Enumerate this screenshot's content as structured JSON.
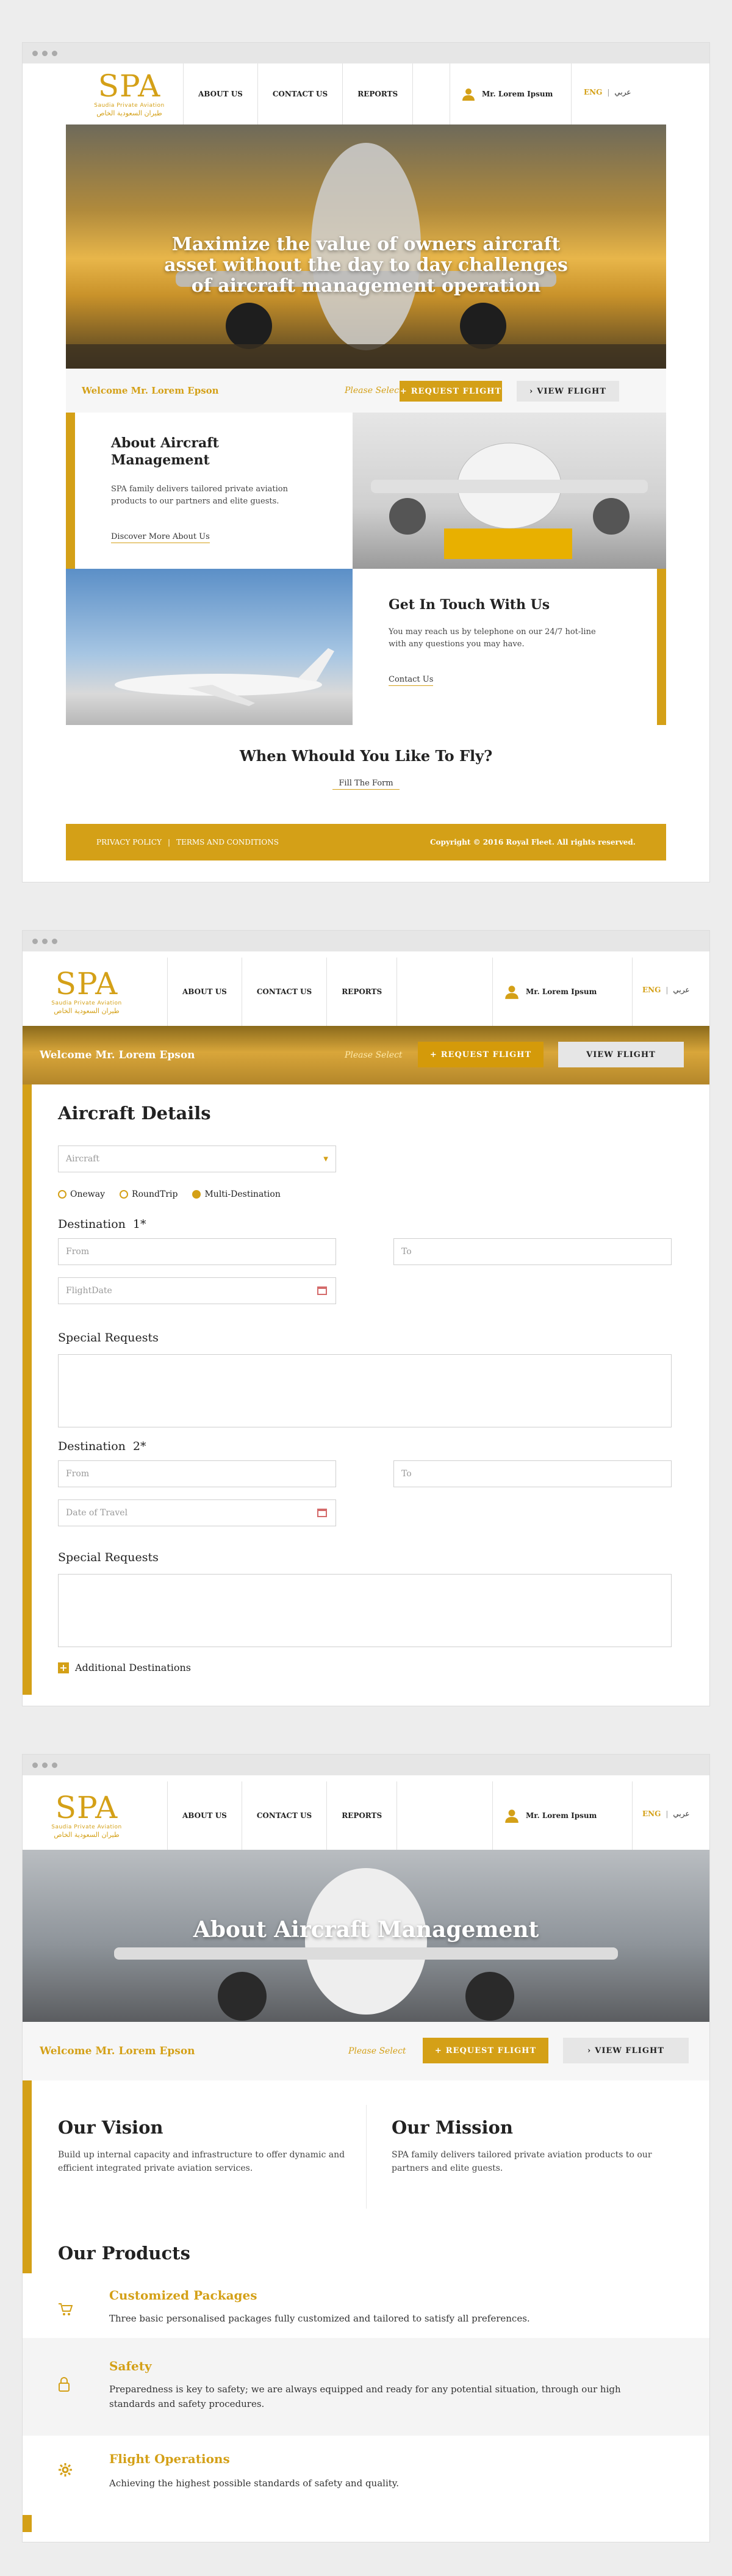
{
  "brand": {
    "logo_text": "SPA",
    "logo_sub": "Saudia Private Aviation",
    "logo_ar": "طيران السعودية الخاص"
  },
  "nav": [
    "ABOUT US",
    "CONTACT US",
    "REPORTS"
  ],
  "user": {
    "name": "Mr. Lorem Ipsum"
  },
  "lang": {
    "en": "ENG",
    "sep": "|",
    "ar": "عربي"
  },
  "screen1": {
    "hero_title": "Maximize the value of owners aircraft asset without the day to day challenges of aircraft management operation",
    "welcome": "Welcome Mr. Lorem Epson",
    "please_select": "Please Select",
    "request_flight": "REQUEST FLIGHT",
    "view_flight": "VIEW FLIGHT",
    "about_title": "About Aircraft Management",
    "about_text": "SPA family delivers tailored private aviation products to our partners and elite guests.",
    "about_link": "Discover More About Us",
    "touch_title": "Get In Touch With Us",
    "touch_text": "You may reach us by telephone on our 24/7 hot-line with any questions you may have.",
    "touch_link": "Contact Us",
    "fly_title": "When Whould You Like To Fly?",
    "fly_link": "Fill The Form",
    "footer_privacy": "PRIVACY POLICY",
    "footer_sep": "|",
    "footer_terms": "TERMS AND CONDITIONS",
    "footer_copy": "Copyright © 2016 Royal Fleet. All rights reserved."
  },
  "screen2": {
    "welcome": "Welcome Mr. Lorem Epson",
    "please_select": "Please Select",
    "request_flight": "REQUEST FLIGHT",
    "view_flight": "VIEW FLIGHT",
    "section_title": "Aircraft Details",
    "aircraft_placeholder": "Aircraft",
    "trip_types": [
      "Oneway",
      "RoundTrip",
      "Multi-Destination"
    ],
    "selected_trip": 2,
    "dest1_label": "Destination",
    "dest1_num": "1*",
    "from_placeholder": "From",
    "to_placeholder": "To",
    "flight_date_placeholder": "FlightDate",
    "special_requests": "Special Requests",
    "dest2_label": "Destination",
    "dest2_num": "2*",
    "date_travel_placeholder": "Date of Travel",
    "additional": "Additional Destinations"
  },
  "screen3": {
    "hero_title": "About Aircraft Management",
    "welcome": "Welcome Mr. Lorem Epson",
    "please_select": "Please Select",
    "request_flight": "REQUEST FLIGHT",
    "view_flight": "VIEW FLIGHT",
    "vision_title": "Our Vision",
    "vision_text": "Build up internal capacity and infrastructure to offer dynamic and efficient integrated private aviation services.",
    "mission_title": "Our Mission",
    "mission_text": "SPA family delivers tailored private aviation products to our partners and elite guests.",
    "products_title": "Our Products",
    "products": [
      {
        "title": "Customized Packages",
        "text": "Three basic personalised packages fully customized and tailored to satisfy all preferences.",
        "icon": "cart-icon"
      },
      {
        "title": "Safety",
        "text": "Preparedness is key to safety; we are always equipped and ready for any potential situation, through our high standards and safety procedures.",
        "icon": "lock-icon"
      },
      {
        "title": "Flight Operations",
        "text": "Achieving the highest possible standards of safety and quality.",
        "icon": "gear-icon"
      }
    ]
  },
  "colors": {
    "gold": "#d4a017",
    "grey_btn": "#e6e6e6"
  }
}
